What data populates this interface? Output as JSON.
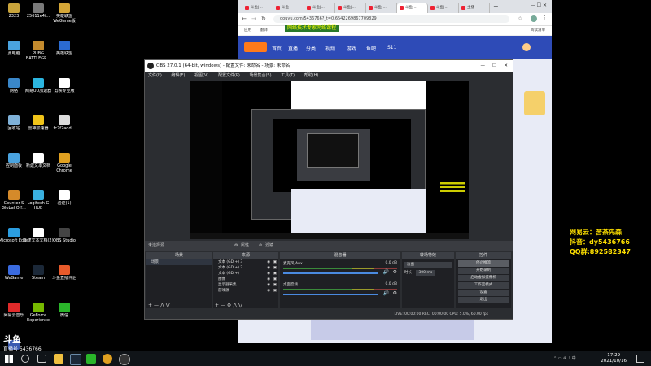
{
  "desktop": {
    "icons": [
      {
        "label": "2323",
        "color": "#c9a43b"
      },
      {
        "label": "25611e4f...",
        "color": "#7a7a7a"
      },
      {
        "label": "英雄联盟WeGame版",
        "color": "#d4a637"
      },
      {
        "label": "此电脑",
        "color": "#4aa3df"
      },
      {
        "label": "PUBG BATTLEGR...",
        "color": "#c48b2e"
      },
      {
        "label": "英雄联盟",
        "color": "#2b6bd1"
      },
      {
        "label": "网络",
        "color": "#3a87c9"
      },
      {
        "label": "网易UU加速器",
        "color": "#2cb6e0"
      },
      {
        "label": "剪映专业版",
        "color": "#ffffff"
      },
      {
        "label": "回收站",
        "color": "#7fb1d8"
      },
      {
        "label": "雷神加速器",
        "color": "#f0c419"
      },
      {
        "label": "fc7f2add...",
        "color": "#dddddd"
      },
      {
        "label": "控制面板",
        "color": "#4aa3df"
      },
      {
        "label": "新建文本文档",
        "color": "#ffffff"
      },
      {
        "label": "Google Chrome",
        "color": "#e0a020"
      },
      {
        "label": "Counter-S Global Off...",
        "color": "#d58a2a"
      },
      {
        "label": "Logitech G HUB",
        "color": "#3ab0e0"
      },
      {
        "label": "验证(1)",
        "color": "#ffffff"
      },
      {
        "label": "Microsoft Edge",
        "color": "#2b9de0"
      },
      {
        "label": "新建文本文档(2)",
        "color": "#ffffff"
      },
      {
        "label": "OBS Studio",
        "color": "#444444"
      },
      {
        "label": "WeGame",
        "color": "#3a6be0"
      },
      {
        "label": "Steam",
        "color": "#1b2838"
      },
      {
        "label": "斗鱼直播伴侣",
        "color": "#e85a2a"
      },
      {
        "label": "网易云音乐",
        "color": "#e02a2a"
      },
      {
        "label": "GeForce Experience",
        "color": "#76b900"
      },
      {
        "label": "微信",
        "color": "#2ab52a"
      },
      {
        "label": "Wallpaper Engine: ...",
        "color": "#3a5ab0"
      }
    ]
  },
  "taskbar": {
    "time": "17:29",
    "date": "2021/10/16"
  },
  "browser": {
    "tabs": [
      "斗鱼|...",
      "斗鱼",
      "斗鱼|...",
      "斗鱼|...",
      "斗鱼|...",
      "斗鱼|...",
      "斗鱼|...",
      "主播"
    ],
    "url": "douyu.com/5436766?_t=0.6542269867709829",
    "bookmarks": [
      "应用",
      "翻译",
      "阅读清单"
    ],
    "nav": [
      "首页",
      "直播",
      "分类",
      "视频",
      "游戏",
      "鱼吧",
      "S11"
    ],
    "marquee": "网络技术专家网络课程"
  },
  "obs": {
    "title": "OBS 27.0.1 (64-bit, windows) - 配置文件: 未命名 - 场景: 未命名",
    "menu": [
      "文件(F)",
      "编辑(E)",
      "视图(V)",
      "配置文件(P)",
      "场景集合(S)",
      "工具(T)",
      "帮助(H)"
    ],
    "status_left": "未选择源",
    "btn_props": "属性",
    "btn_filter": "滤镜",
    "docks": {
      "scenes": "场景",
      "sources": "来源",
      "mixer": "混音器",
      "transitions": "转场特效",
      "controls": "控件"
    },
    "scene_item": "场景",
    "sources": [
      "文本 (GDI+) 3",
      "文本 (GDI+) 2",
      "文本 (GDI+)",
      "图像",
      "显示器采集",
      "游戏源"
    ],
    "mixer": [
      {
        "name": "麦克风/Aux",
        "level": "0.0 dB"
      },
      {
        "name": "桌面音频",
        "level": "0.0 dB"
      }
    ],
    "transition": "淡出",
    "duration_label": "时长",
    "duration": "300 ms",
    "controls": [
      "停止推流",
      "开始录制",
      "启动虚拟摄像机",
      "工作室模式",
      "设置",
      "退出"
    ],
    "footer": "LIVE: 00:00:00   REC: 00:00:00   CPU: 5.0%, 60.00 fps"
  },
  "overlay": {
    "line1": "网易云：苦茶先森",
    "line2": "抖音：dy5436766",
    "line3": "QQ群:892582347"
  },
  "logo": {
    "main": "斗鱼",
    "sub": "直播号",
    "id": "5436766"
  }
}
